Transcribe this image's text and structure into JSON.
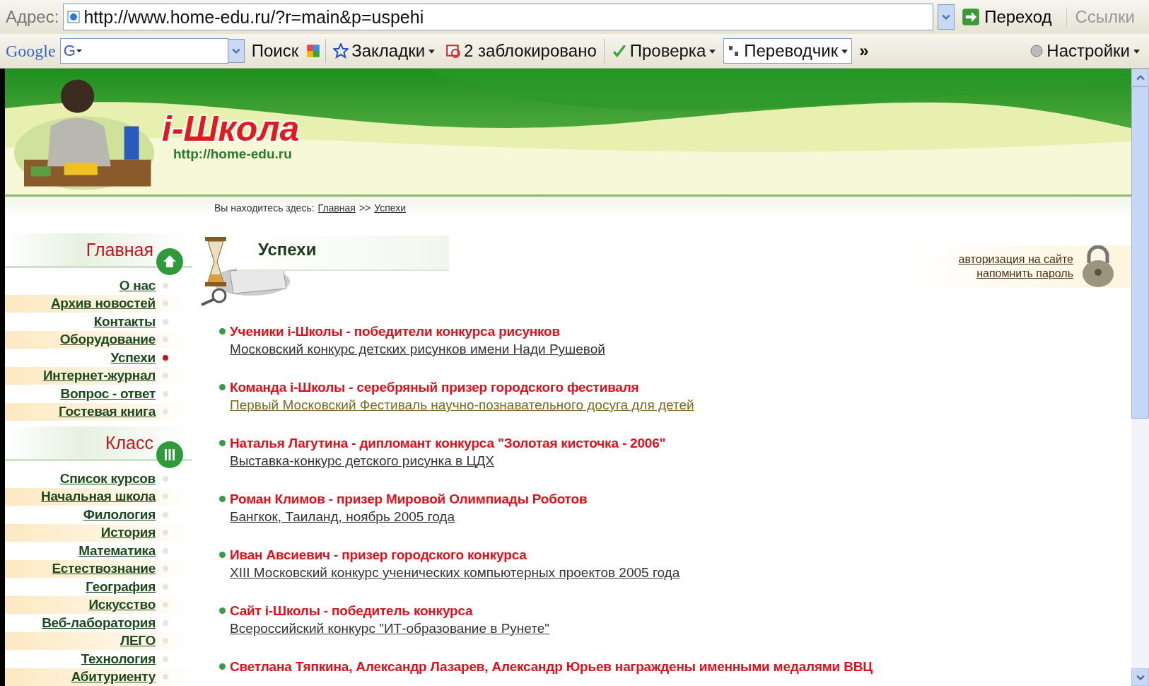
{
  "address_bar": {
    "label": "Адрес:",
    "url": "http://www.home-edu.ru/?r=main&p=uspehi",
    "go_button": "Переход",
    "links": "Ссылки"
  },
  "google_toolbar": {
    "logo": "Google",
    "field_icon": "G",
    "search_button": "Поиск",
    "bookmarks": "Закладки",
    "blocked": "2 заблокировано",
    "spellcheck": "Проверка",
    "translator": "Переводчик",
    "more": "»",
    "settings": "Настройки"
  },
  "header": {
    "logo": "i-Школа",
    "url": "http://home-edu.ru"
  },
  "breadcrumb": {
    "label": "Вы находитесь здесь:",
    "links": [
      "Главная",
      "Успехи"
    ],
    "separator": ">>"
  },
  "sidebar": [
    {
      "title": "Главная",
      "items": [
        {
          "label": "О нас",
          "selected": false
        },
        {
          "label": "Архив новостей",
          "selected": false
        },
        {
          "label": "Контакты",
          "selected": false
        },
        {
          "label": "Оборудование",
          "selected": false
        },
        {
          "label": "Успехи",
          "selected": true
        },
        {
          "label": "Интернет-журнал",
          "selected": false
        },
        {
          "label": "Вопрос - ответ",
          "selected": false
        },
        {
          "label": "Гостевая книга",
          "selected": false
        }
      ]
    },
    {
      "title": "Класс",
      "items": [
        {
          "label": "Список курсов",
          "selected": false
        },
        {
          "label": "Начальная школа",
          "selected": false
        },
        {
          "label": "Филология",
          "selected": false
        },
        {
          "label": "История",
          "selected": false
        },
        {
          "label": "Математика",
          "selected": false
        },
        {
          "label": "Естествознание",
          "selected": false
        },
        {
          "label": "География",
          "selected": false
        },
        {
          "label": "Искусство",
          "selected": false
        },
        {
          "label": "Веб-лаборатория",
          "selected": false
        },
        {
          "label": "ЛЕГО",
          "selected": false
        },
        {
          "label": "Технология",
          "selected": false
        },
        {
          "label": "Абитуриенту",
          "selected": false
        }
      ]
    }
  ],
  "page_title": "Успехи",
  "auth_links": [
    "авторизация на сайте",
    "напомнить пароль"
  ],
  "news": [
    {
      "title": "Ученики i-Школы - победители конкурса рисунков",
      "subtitle": "Московский конкурс детских рисунков имени Нади Рушевой",
      "visited": false
    },
    {
      "title": "Команда i-Школы - серебряный призер городского фестиваля",
      "subtitle": "Первый Московский Фестиваль научно-познавательного досуга для детей",
      "visited": true
    },
    {
      "title": "Наталья Лагутина - дипломант конкурса \"Золотая кисточка - 2006\"",
      "subtitle": "Выставка-конкурс детского рисунка в ЦДХ",
      "visited": false
    },
    {
      "title": "Роман Климов - призер Мировой Олимпиады Роботов",
      "subtitle": "Бангкок, Таиланд, ноябрь 2005 года",
      "visited": false
    },
    {
      "title": "Иван Авсиевич - призер городского конкурса",
      "subtitle": "XIII Московский конкурс ученических компьютерных проектов 2005 года",
      "visited": false
    },
    {
      "title": "Сайт i-Школы - победитель конкурса",
      "subtitle": "Всероссийский конкурс \"ИТ-образование в Рунете\"",
      "visited": false
    },
    {
      "title": "Светлана Тяпкина, Александр Лазарев, Александр Юрьев награждены именными медалями ВВЦ"
    }
  ]
}
